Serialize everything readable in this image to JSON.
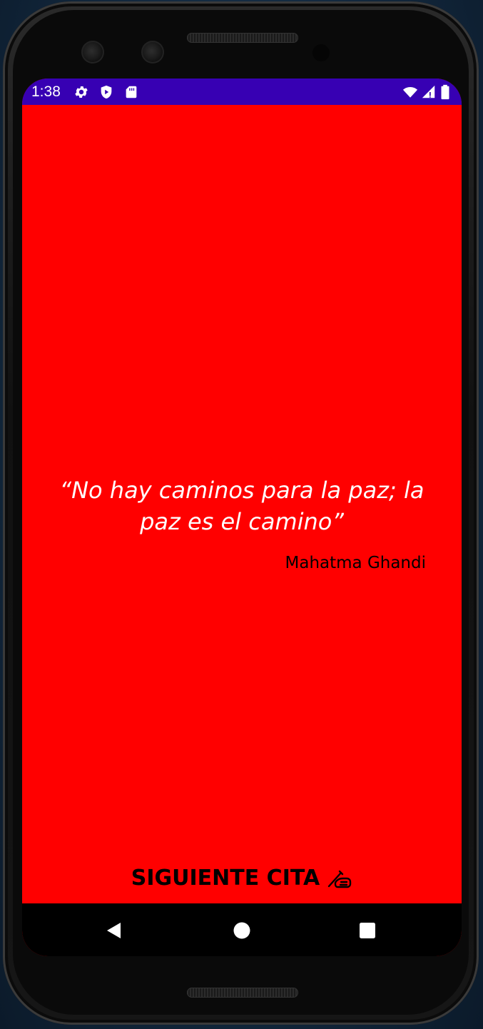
{
  "status_bar": {
    "time": "1:38",
    "left_icons": [
      "gear-icon",
      "shield-play-icon",
      "sd-card-icon"
    ],
    "right_icons": [
      "wifi-icon",
      "signal-icon",
      "battery-icon"
    ],
    "color": "#3700b3"
  },
  "main": {
    "background_color": "#ff0000",
    "quote": "“No hay caminos para la paz; la paz es el camino”",
    "author": "Mahatma Ghandi",
    "next_button_label": "SIGUIENTE CITA",
    "next_button_icon": "writing-hand-icon"
  },
  "nav_bar": {
    "buttons": [
      "back-icon",
      "home-icon",
      "recents-icon"
    ]
  }
}
